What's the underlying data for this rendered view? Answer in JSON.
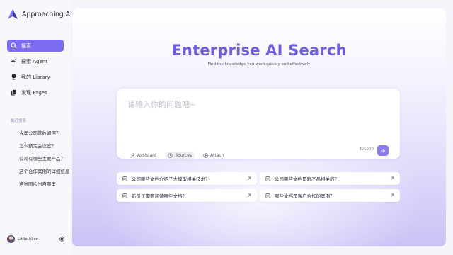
{
  "brand": {
    "name": "Approaching.AI"
  },
  "nav": [
    {
      "label": "搜索",
      "icon": "search-icon",
      "active": true
    },
    {
      "label": "探索 Agent",
      "icon": "sparkle-icon",
      "active": false
    },
    {
      "label": "我的 Library",
      "icon": "library-icon",
      "active": false
    },
    {
      "label": "发现 Pages",
      "icon": "pages-icon",
      "active": false
    }
  ],
  "recent": {
    "title": "最近搜索",
    "items": [
      "今年公司营收如何？",
      "怎么预定会议室？",
      "公司有哪些主要产品？",
      "这个合作案例的详细信息",
      "这张图片出自哪里"
    ]
  },
  "user": {
    "name": "Little Allen"
  },
  "main": {
    "title": "Enterprise AI Search",
    "subtitle": "Find the knowledge you want quickly and effectively"
  },
  "search": {
    "placeholder": "请输入你的问题吧~",
    "value": "",
    "counter": "0/1000",
    "options": [
      {
        "label": "Assistant",
        "icon": "person-icon"
      },
      {
        "label": "Sources",
        "icon": "clock-icon"
      },
      {
        "label": "Attach",
        "icon": "plus-circle-icon"
      }
    ]
  },
  "suggestions": [
    "公司哪些文档介绍了大模型相关技术？",
    "公司哪些文档是跟产品相关的？",
    "新员工需要阅读哪些文档？",
    "哪些文档是客户合作的案例？"
  ],
  "colors": {
    "accent": "#7c6cf0",
    "title": "#6b5ee0"
  }
}
